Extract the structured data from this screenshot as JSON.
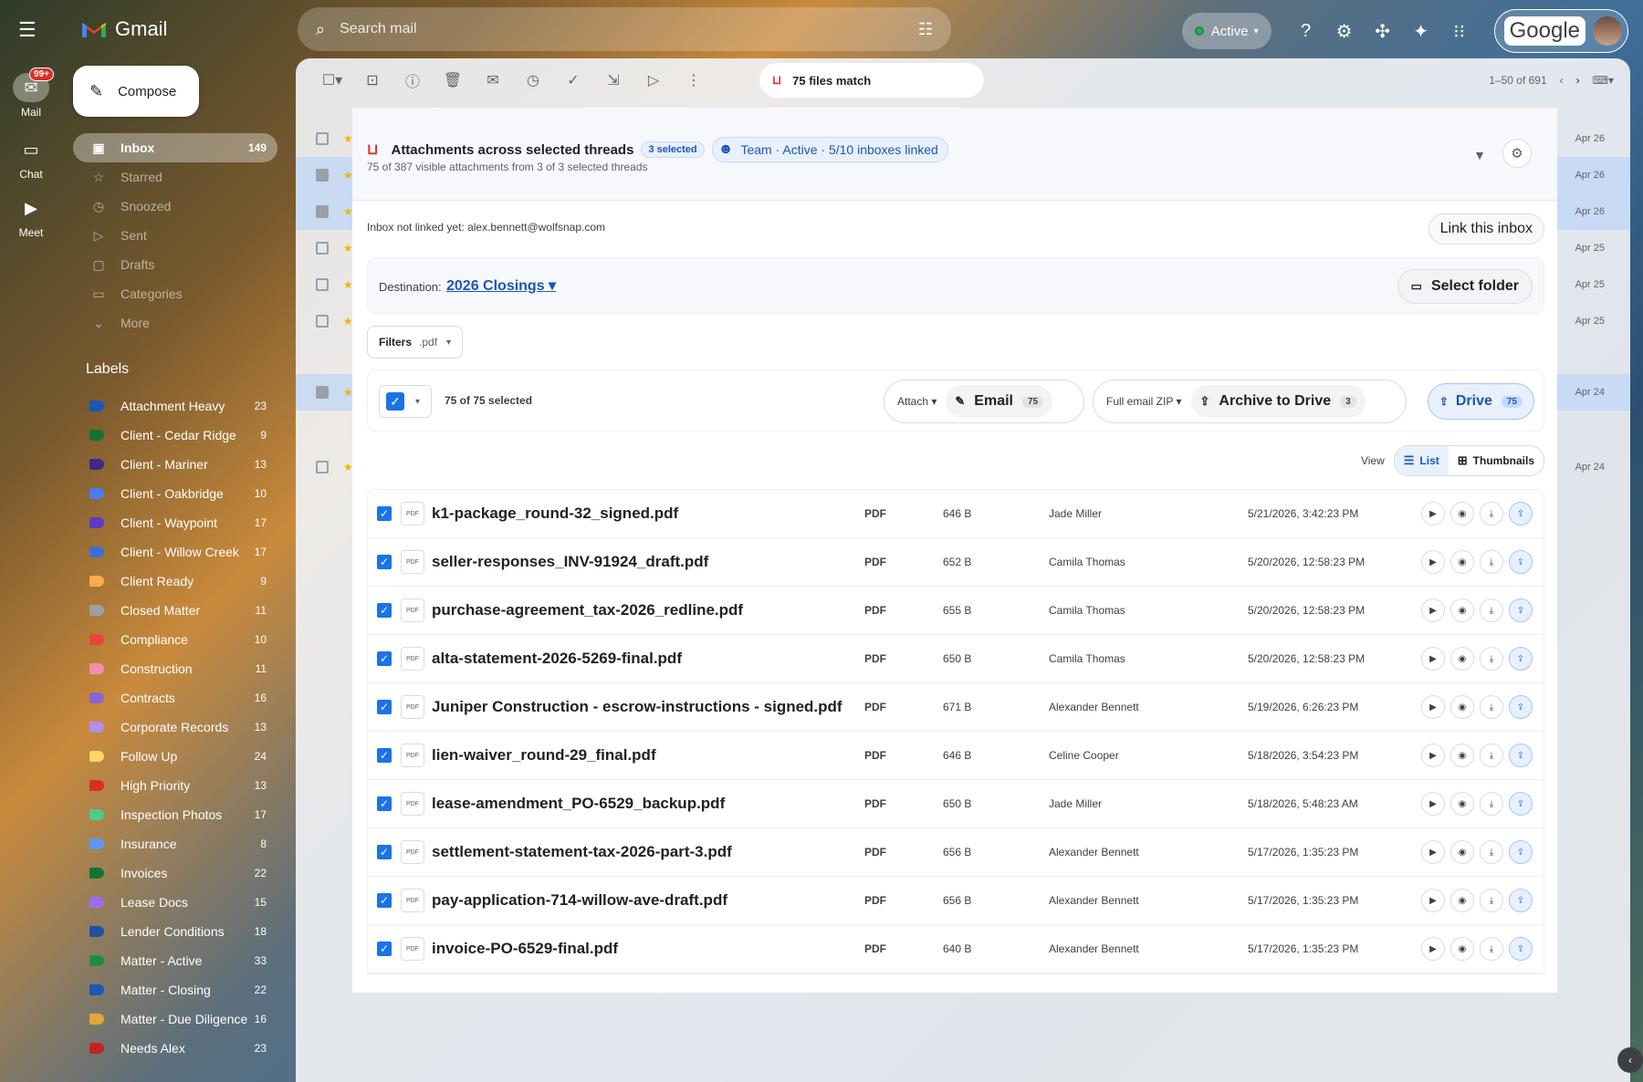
{
  "rail": {
    "mail_label": "Mail",
    "mail_badge": "99+",
    "chat_label": "Chat",
    "meet_label": "Meet"
  },
  "brand": {
    "name": "Gmail"
  },
  "compose": {
    "label": "Compose"
  },
  "nav": [
    {
      "label": "Inbox",
      "count": "149",
      "icon": "inbox-icon",
      "glyph": "▣"
    },
    {
      "label": "Starred",
      "count": "",
      "icon": "star-icon",
      "glyph": "☆"
    },
    {
      "label": "Snoozed",
      "count": "",
      "icon": "clock-icon",
      "glyph": "◷"
    },
    {
      "label": "Sent",
      "count": "",
      "icon": "send-icon",
      "glyph": "▷"
    },
    {
      "label": "Drafts",
      "count": "",
      "icon": "draft-icon",
      "glyph": "▢"
    },
    {
      "label": "Categories",
      "count": "",
      "icon": "label-icon",
      "glyph": "▭"
    },
    {
      "label": "More",
      "count": "",
      "icon": "chevron-down-icon",
      "glyph": "⌄"
    }
  ],
  "labels_heading": "Labels",
  "labels": [
    {
      "name": "Attachment Heavy",
      "count": "23",
      "color": "#1a56b5"
    },
    {
      "name": "Client - Cedar Ridge",
      "count": "9",
      "color": "#137333"
    },
    {
      "name": "Client - Mariner",
      "count": "13",
      "color": "#3b2a8a"
    },
    {
      "name": "Client - Oakbridge",
      "count": "10",
      "color": "#4a7bf0"
    },
    {
      "name": "Client - Waypoint",
      "count": "17",
      "color": "#5b3cc4"
    },
    {
      "name": "Client - Willow Creek",
      "count": "17",
      "color": "#3c6fd6"
    },
    {
      "name": "Client Ready",
      "count": "9",
      "color": "#f6ae4a"
    },
    {
      "name": "Closed Matter",
      "count": "11",
      "color": "#9aa0a6"
    },
    {
      "name": "Compliance",
      "count": "10",
      "color": "#e8453c"
    },
    {
      "name": "Construction",
      "count": "11",
      "color": "#f28fb1"
    },
    {
      "name": "Contracts",
      "count": "16",
      "color": "#8a63d2"
    },
    {
      "name": "Corporate Records",
      "count": "13",
      "color": "#b58cf0"
    },
    {
      "name": "Follow Up",
      "count": "24",
      "color": "#fdd663"
    },
    {
      "name": "High Priority",
      "count": "13",
      "color": "#d93025"
    },
    {
      "name": "Inspection Photos",
      "count": "17",
      "color": "#4ecb8a"
    },
    {
      "name": "Insurance",
      "count": "8",
      "color": "#5e97f6"
    },
    {
      "name": "Invoices",
      "count": "22",
      "color": "#137333"
    },
    {
      "name": "Lease Docs",
      "count": "15",
      "color": "#9c6cf5"
    },
    {
      "name": "Lender Conditions",
      "count": "18",
      "color": "#1f4fa8"
    },
    {
      "name": "Matter - Active",
      "count": "33",
      "color": "#1e8e3e"
    },
    {
      "name": "Matter - Closing",
      "count": "22",
      "color": "#1a56b5"
    },
    {
      "name": "Matter - Due Diligence",
      "count": "16",
      "color": "#e8a33c"
    },
    {
      "name": "Needs Alex",
      "count": "23",
      "color": "#c5221f"
    }
  ],
  "search": {
    "placeholder": "Search mail"
  },
  "topbar": {
    "status": "Active",
    "google_word": "Google"
  },
  "toolbar": {
    "files_match": "75 files match",
    "pager": "1–50 of 691"
  },
  "background_dates": [
    "Apr 26",
    "Apr 26",
    "Apr 26",
    "Apr 25",
    "Apr 25",
    "Apr 25",
    "Apr 24",
    "Apr 24"
  ],
  "modal": {
    "title": "Attachments across selected threads",
    "selected_badge": "3 selected",
    "team_pill": "Team · Active · 5/10 inboxes linked",
    "subtitle": "75 of 387 visible attachments from 3 of 3 selected threads",
    "not_linked": "Inbox not linked yet: alex.bennett@wolfsnap.com",
    "link_button": "Link this inbox",
    "destination_label": "Destination:",
    "destination_value": "2026 Closings ▾",
    "select_folder": "Select folder",
    "filters_label": "Filters",
    "filters_value": ".pdf",
    "selected_count": "75 of 75 selected",
    "attach_label": "Attach",
    "email_button": "Email",
    "email_count": "75",
    "zip_label": "Full email ZIP",
    "archive_button": "Archive to Drive",
    "archive_count": "3",
    "drive_button": "Drive",
    "drive_count": "75",
    "view_label": "View",
    "view_list": "List",
    "view_thumbs": "Thumbnails"
  },
  "files": [
    {
      "name": "k1-package_round-32_signed.pdf",
      "type": "PDF",
      "size": "646 B",
      "sender": "Jade Miller",
      "date": "5/21/2026, 3:42:23 PM"
    },
    {
      "name": "seller-responses_INV-91924_draft.pdf",
      "type": "PDF",
      "size": "652 B",
      "sender": "Camila Thomas",
      "date": "5/20/2026, 12:58:23 PM"
    },
    {
      "name": "purchase-agreement_tax-2026_redline.pdf",
      "type": "PDF",
      "size": "655 B",
      "sender": "Camila Thomas",
      "date": "5/20/2026, 12:58:23 PM"
    },
    {
      "name": "alta-statement-2026-5269-final.pdf",
      "type": "PDF",
      "size": "650 B",
      "sender": "Camila Thomas",
      "date": "5/20/2026, 12:58:23 PM"
    },
    {
      "name": "Juniper Construction - escrow-instructions - signed.pdf",
      "type": "PDF",
      "size": "671 B",
      "sender": "Alexander Bennett",
      "date": "5/19/2026, 6:26:23 PM"
    },
    {
      "name": "lien-waiver_round-29_final.pdf",
      "type": "PDF",
      "size": "646 B",
      "sender": "Celine Cooper",
      "date": "5/18/2026, 3:54:23 PM"
    },
    {
      "name": "lease-amendment_PO-6529_backup.pdf",
      "type": "PDF",
      "size": "650 B",
      "sender": "Jade Miller",
      "date": "5/18/2026, 5:48:23 AM"
    },
    {
      "name": "settlement-statement-tax-2026-part-3.pdf",
      "type": "PDF",
      "size": "656 B",
      "sender": "Alexander Bennett",
      "date": "5/17/2026, 1:35:23 PM"
    },
    {
      "name": "pay-application-714-willow-ave-draft.pdf",
      "type": "PDF",
      "size": "656 B",
      "sender": "Alexander Bennett",
      "date": "5/17/2026, 1:35:23 PM"
    },
    {
      "name": "invoice-PO-6529-final.pdf",
      "type": "PDF",
      "size": "640 B",
      "sender": "Alexander Bennett",
      "date": "5/17/2026, 1:35:23 PM"
    }
  ]
}
